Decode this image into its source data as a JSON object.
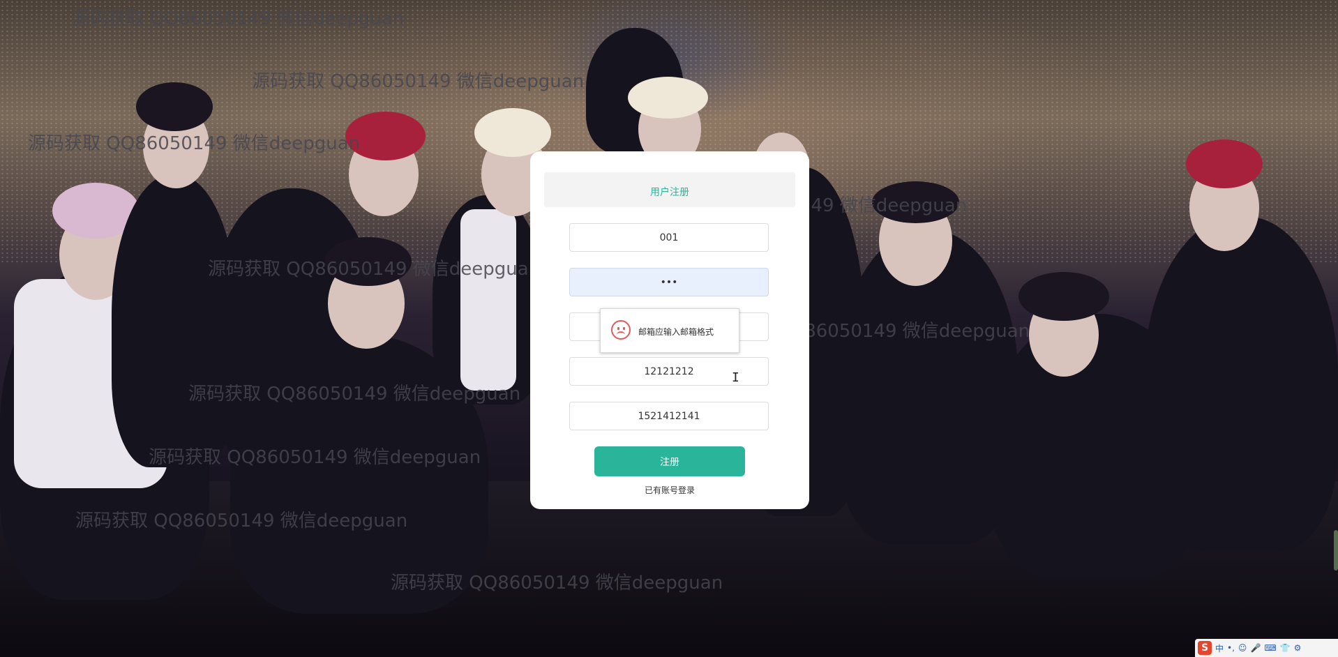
{
  "watermarks": [
    "源码获取 QQ86050149 微信deepguan",
    "源码获取 QQ86050149 微信deepguan",
    "源码获取 QQ86050149 微信deepguan",
    "源码获取 QQ86050149 微信deepguan",
    "源码获取 QQ86050149 微信deepguan",
    "源码获取 QQ86050149 微信deepguan",
    "源码获取 QQ86050149 微信deepguan",
    "源码获取 QQ86050149 微信deepguan",
    "源码获取 QQ86050149 微信deepguan",
    "源码获取 QQ86050149 微信deepguan"
  ],
  "form": {
    "title": "用户注册",
    "username": "001",
    "password": "•••",
    "email": "",
    "field4": "12121212",
    "phone": "1521412141",
    "submit_label": "注册",
    "login_link": "已有账号登录"
  },
  "toast": {
    "message": "邮箱应输入邮箱格式",
    "icon": "sad-face-icon"
  },
  "cursor": "I",
  "tray": {
    "logo": "S",
    "items": [
      "中",
      "•,",
      "☺",
      "🎤",
      "⌨",
      "👕",
      "⚙"
    ]
  },
  "colors": {
    "accent": "#2ab59a",
    "error": "#e05a5a"
  }
}
